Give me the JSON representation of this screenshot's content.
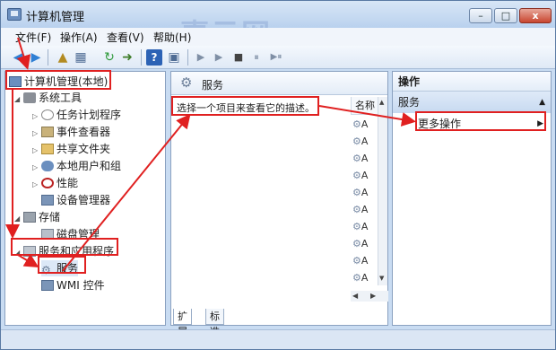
{
  "window": {
    "title": "计算机管理",
    "min_glyph": "–",
    "max_glyph": "□",
    "close_glyph": "x"
  },
  "watermark": "壹云网",
  "menu": [
    "文件(F)",
    "操作(A)",
    "查看(V)",
    "帮助(H)"
  ],
  "toolbar": {
    "back_icon": "back-arrow-icon",
    "forward_icon": "forward-arrow-icon",
    "play_glyph": "▶",
    "stop_glyph": "■",
    "pause_glyph": "⏸",
    "restart_glyph": "▶⏸"
  },
  "tree": {
    "root": "计算机管理(本地)",
    "system_tools": "系统工具",
    "items": [
      "任务计划程序",
      "事件查看器",
      "共享文件夹",
      "本地用户和组",
      "性能",
      "设备管理器"
    ],
    "storage": "存储",
    "disk_mgmt": "磁盘管理",
    "services_apps": "服务和应用程序",
    "services": "服务",
    "wmi": "WMI 控件"
  },
  "middle": {
    "header": "服务",
    "description": "选择一个项目来查看它的描述。",
    "column_name": "名称",
    "rows": [
      "A",
      "A",
      "A",
      "A",
      "A",
      "A",
      "A",
      "A",
      "A",
      "A",
      "A"
    ],
    "tabs": [
      "扩展",
      "标准"
    ]
  },
  "actions": {
    "header": "操作",
    "section": "服务",
    "more": "更多操作"
  },
  "colors": {
    "highlight": "#e02020",
    "titlebar": "#b9d1ee",
    "section_bg": "#c7d9f0"
  }
}
